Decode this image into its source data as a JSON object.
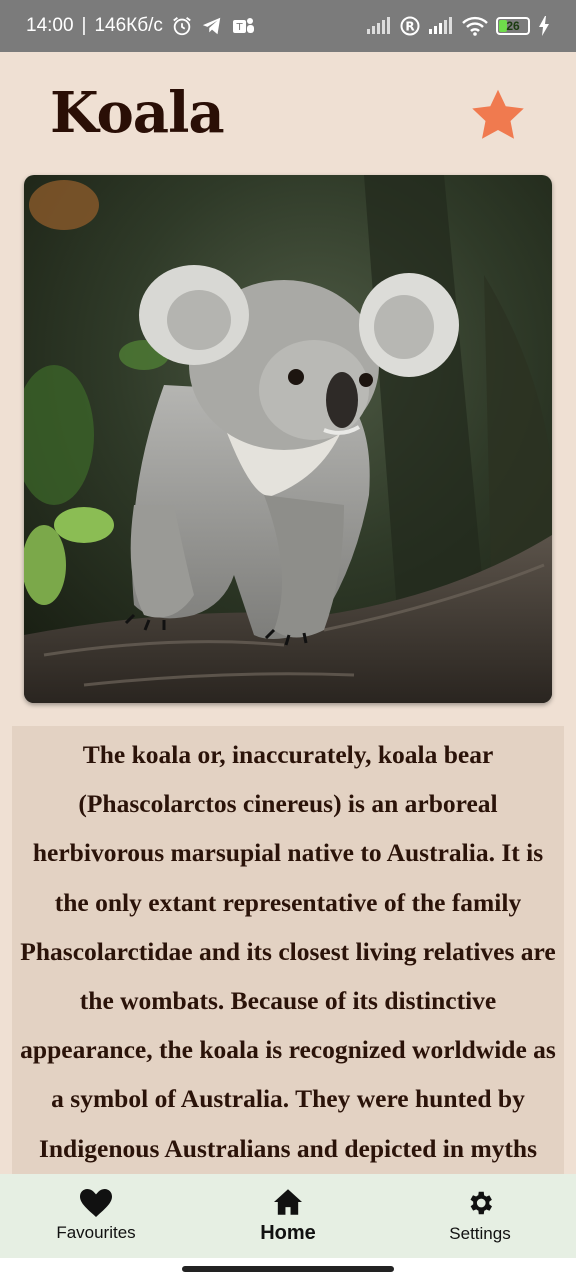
{
  "status_bar": {
    "time": "14:00",
    "network_speed": "146Кб/с",
    "battery_level": "26",
    "icons": [
      "alarm-icon",
      "telegram-icon",
      "teams-icon",
      "signal-icon",
      "roaming-r-icon",
      "signal-icon",
      "wifi-icon",
      "battery-icon",
      "charging-icon"
    ]
  },
  "header": {
    "title": "Koala",
    "favorite_icon": "star-icon",
    "favorite_color": "#f07a4f"
  },
  "photo": {
    "subject": "koala-photo"
  },
  "description": "The koala or, inaccurately, koala bear (Phascolarctos cinereus) is an arboreal herbivorous marsupial native to Australia. It is the only extant representative of the family Phascolarctidae and its closest living relatives are the wombats. Because of its distinctive appearance, the koala is recognized worldwide as a symbol of Australia. They were hunted by Indigenous Australians and depicted in myths and cave art for millennia. The first recorded",
  "bottom_nav": {
    "items": [
      {
        "label": "Favourites",
        "icon": "heart-icon"
      },
      {
        "label": "Home",
        "icon": "home-icon",
        "active": true
      },
      {
        "label": "Settings",
        "icon": "gear-icon"
      }
    ]
  },
  "colors": {
    "background": "#efe0d3",
    "text_panel": "#e3d2c3",
    "title_text": "#2a0f06",
    "nav_background": "#e6efe3"
  }
}
